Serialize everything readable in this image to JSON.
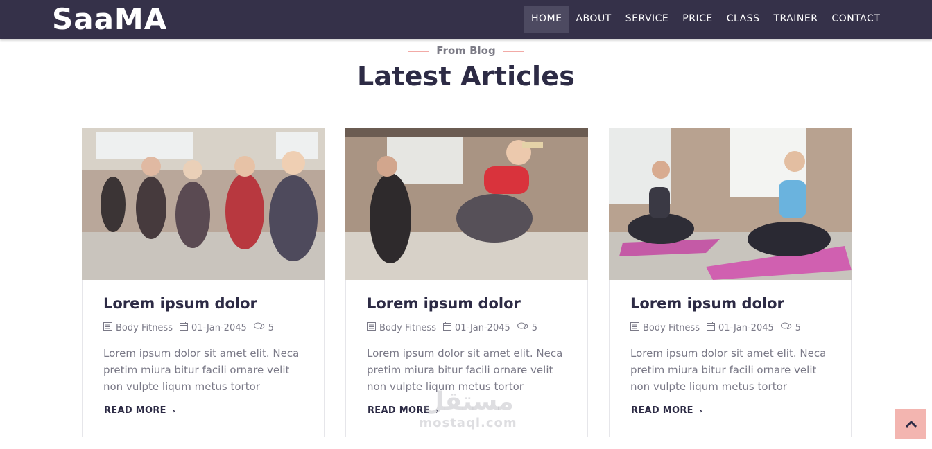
{
  "brand": "SaaMA",
  "nav": {
    "items": [
      "HOME",
      "ABOUT",
      "SERVICE",
      "PRICE",
      "CLASS",
      "TRAINER",
      "CONTACT"
    ],
    "active": "HOME"
  },
  "section": {
    "eyebrow": "From Blog",
    "title": "Latest Articles"
  },
  "articles": [
    {
      "image": "group-sitting-fitness-photo",
      "title": "Lorem ipsum dolor",
      "category": "Body Fitness",
      "date": "01-Jan-2045",
      "comments": "5",
      "excerpt": "Lorem ipsum dolor sit amet elit. Neca pretim miura bitur facili ornare velit non vulpte liqum metus tortor",
      "read_more": "READ MORE"
    },
    {
      "image": "high-five-workout-photo",
      "title": "Lorem ipsum dolor",
      "category": "Body Fitness",
      "date": "01-Jan-2045",
      "comments": "5",
      "excerpt": "Lorem ipsum dolor sit amet elit. Neca pretim miura bitur facili ornare velit non vulpte liqum metus tortor",
      "read_more": "READ MORE"
    },
    {
      "image": "yoga-mat-photo",
      "title": "Lorem ipsum dolor",
      "category": "Body Fitness",
      "date": "01-Jan-2045",
      "comments": "5",
      "excerpt": "Lorem ipsum dolor sit amet elit. Neca pretim miura bitur facili ornare velit non vulpte liqum metus tortor",
      "read_more": "READ MORE"
    }
  ],
  "watermark": {
    "arabic": "مستقل",
    "latin": "mostaql.com"
  },
  "colors": {
    "navbar": "#353149",
    "accent": "#f3b5b0",
    "heading": "#2d2b45"
  }
}
